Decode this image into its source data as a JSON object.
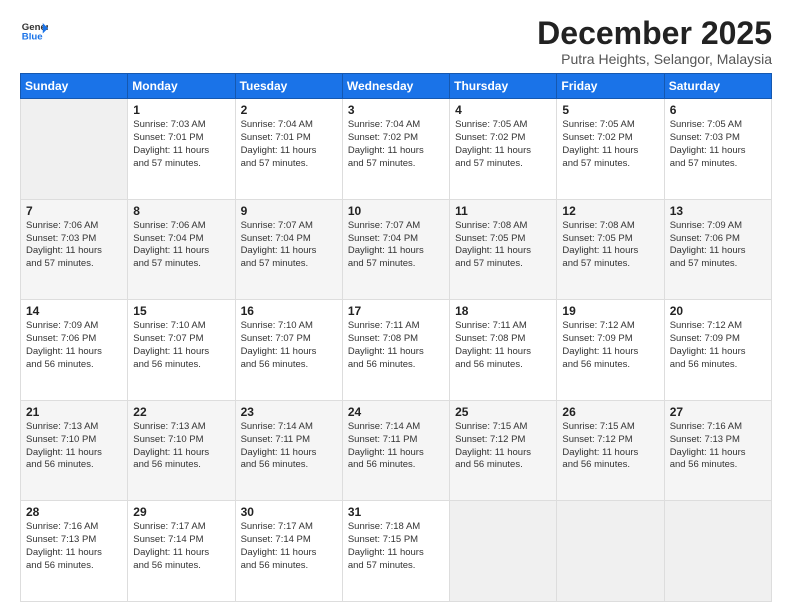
{
  "logo": {
    "line1": "General",
    "line2": "Blue"
  },
  "title": "December 2025",
  "subtitle": "Putra Heights, Selangor, Malaysia",
  "header_days": [
    "Sunday",
    "Monday",
    "Tuesday",
    "Wednesday",
    "Thursday",
    "Friday",
    "Saturday"
  ],
  "weeks": [
    [
      {
        "day": "",
        "info": ""
      },
      {
        "day": "1",
        "info": "Sunrise: 7:03 AM\nSunset: 7:01 PM\nDaylight: 11 hours\nand 57 minutes."
      },
      {
        "day": "2",
        "info": "Sunrise: 7:04 AM\nSunset: 7:01 PM\nDaylight: 11 hours\nand 57 minutes."
      },
      {
        "day": "3",
        "info": "Sunrise: 7:04 AM\nSunset: 7:02 PM\nDaylight: 11 hours\nand 57 minutes."
      },
      {
        "day": "4",
        "info": "Sunrise: 7:05 AM\nSunset: 7:02 PM\nDaylight: 11 hours\nand 57 minutes."
      },
      {
        "day": "5",
        "info": "Sunrise: 7:05 AM\nSunset: 7:02 PM\nDaylight: 11 hours\nand 57 minutes."
      },
      {
        "day": "6",
        "info": "Sunrise: 7:05 AM\nSunset: 7:03 PM\nDaylight: 11 hours\nand 57 minutes."
      }
    ],
    [
      {
        "day": "7",
        "info": "Sunrise: 7:06 AM\nSunset: 7:03 PM\nDaylight: 11 hours\nand 57 minutes."
      },
      {
        "day": "8",
        "info": "Sunrise: 7:06 AM\nSunset: 7:04 PM\nDaylight: 11 hours\nand 57 minutes."
      },
      {
        "day": "9",
        "info": "Sunrise: 7:07 AM\nSunset: 7:04 PM\nDaylight: 11 hours\nand 57 minutes."
      },
      {
        "day": "10",
        "info": "Sunrise: 7:07 AM\nSunset: 7:04 PM\nDaylight: 11 hours\nand 57 minutes."
      },
      {
        "day": "11",
        "info": "Sunrise: 7:08 AM\nSunset: 7:05 PM\nDaylight: 11 hours\nand 57 minutes."
      },
      {
        "day": "12",
        "info": "Sunrise: 7:08 AM\nSunset: 7:05 PM\nDaylight: 11 hours\nand 57 minutes."
      },
      {
        "day": "13",
        "info": "Sunrise: 7:09 AM\nSunset: 7:06 PM\nDaylight: 11 hours\nand 57 minutes."
      }
    ],
    [
      {
        "day": "14",
        "info": "Sunrise: 7:09 AM\nSunset: 7:06 PM\nDaylight: 11 hours\nand 56 minutes."
      },
      {
        "day": "15",
        "info": "Sunrise: 7:10 AM\nSunset: 7:07 PM\nDaylight: 11 hours\nand 56 minutes."
      },
      {
        "day": "16",
        "info": "Sunrise: 7:10 AM\nSunset: 7:07 PM\nDaylight: 11 hours\nand 56 minutes."
      },
      {
        "day": "17",
        "info": "Sunrise: 7:11 AM\nSunset: 7:08 PM\nDaylight: 11 hours\nand 56 minutes."
      },
      {
        "day": "18",
        "info": "Sunrise: 7:11 AM\nSunset: 7:08 PM\nDaylight: 11 hours\nand 56 minutes."
      },
      {
        "day": "19",
        "info": "Sunrise: 7:12 AM\nSunset: 7:09 PM\nDaylight: 11 hours\nand 56 minutes."
      },
      {
        "day": "20",
        "info": "Sunrise: 7:12 AM\nSunset: 7:09 PM\nDaylight: 11 hours\nand 56 minutes."
      }
    ],
    [
      {
        "day": "21",
        "info": "Sunrise: 7:13 AM\nSunset: 7:10 PM\nDaylight: 11 hours\nand 56 minutes."
      },
      {
        "day": "22",
        "info": "Sunrise: 7:13 AM\nSunset: 7:10 PM\nDaylight: 11 hours\nand 56 minutes."
      },
      {
        "day": "23",
        "info": "Sunrise: 7:14 AM\nSunset: 7:11 PM\nDaylight: 11 hours\nand 56 minutes."
      },
      {
        "day": "24",
        "info": "Sunrise: 7:14 AM\nSunset: 7:11 PM\nDaylight: 11 hours\nand 56 minutes."
      },
      {
        "day": "25",
        "info": "Sunrise: 7:15 AM\nSunset: 7:12 PM\nDaylight: 11 hours\nand 56 minutes."
      },
      {
        "day": "26",
        "info": "Sunrise: 7:15 AM\nSunset: 7:12 PM\nDaylight: 11 hours\nand 56 minutes."
      },
      {
        "day": "27",
        "info": "Sunrise: 7:16 AM\nSunset: 7:13 PM\nDaylight: 11 hours\nand 56 minutes."
      }
    ],
    [
      {
        "day": "28",
        "info": "Sunrise: 7:16 AM\nSunset: 7:13 PM\nDaylight: 11 hours\nand 56 minutes."
      },
      {
        "day": "29",
        "info": "Sunrise: 7:17 AM\nSunset: 7:14 PM\nDaylight: 11 hours\nand 56 minutes."
      },
      {
        "day": "30",
        "info": "Sunrise: 7:17 AM\nSunset: 7:14 PM\nDaylight: 11 hours\nand 56 minutes."
      },
      {
        "day": "31",
        "info": "Sunrise: 7:18 AM\nSunset: 7:15 PM\nDaylight: 11 hours\nand 57 minutes."
      },
      {
        "day": "",
        "info": ""
      },
      {
        "day": "",
        "info": ""
      },
      {
        "day": "",
        "info": ""
      }
    ]
  ]
}
